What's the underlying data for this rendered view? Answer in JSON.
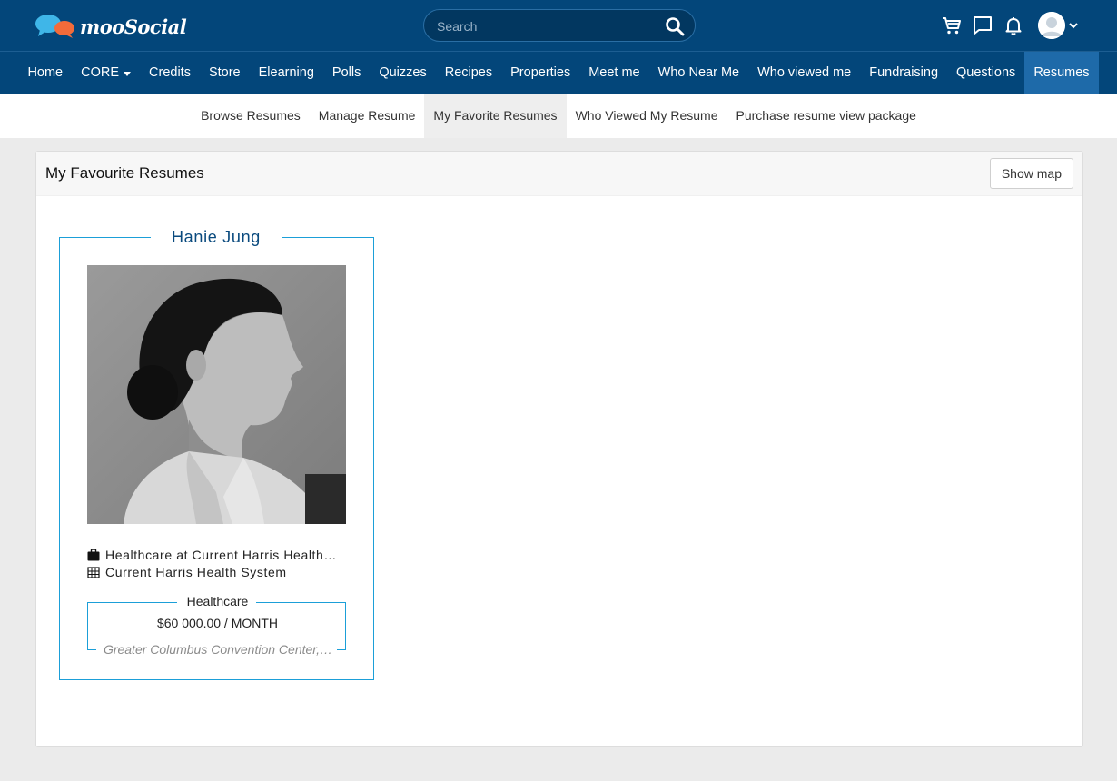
{
  "header": {
    "brand": "mooSocial",
    "search_placeholder": "Search"
  },
  "main_nav": [
    {
      "label": "Home"
    },
    {
      "label": "CORE"
    },
    {
      "label": "Credits"
    },
    {
      "label": "Store"
    },
    {
      "label": "Elearning"
    },
    {
      "label": "Polls"
    },
    {
      "label": "Quizzes"
    },
    {
      "label": "Recipes"
    },
    {
      "label": "Properties"
    },
    {
      "label": "Meet me"
    },
    {
      "label": "Who Near Me"
    },
    {
      "label": "Who viewed me"
    },
    {
      "label": "Fundraising"
    },
    {
      "label": "Questions"
    },
    {
      "label": "Resumes"
    }
  ],
  "sub_nav": [
    {
      "label": "Browse Resumes"
    },
    {
      "label": "Manage Resume"
    },
    {
      "label": "My Favorite Resumes"
    },
    {
      "label": "Who Viewed My Resume"
    },
    {
      "label": "Purchase resume view package"
    }
  ],
  "panel": {
    "title": "My Favourite Resumes",
    "show_map_label": "Show map"
  },
  "resume": {
    "name": "Hanie Jung",
    "job": "Healthcare at Current Harris Health…",
    "company": "Current Harris Health System",
    "category": "Healthcare",
    "salary": "$60 000.00 / MONTH",
    "location": "Greater Columbus Convention Center,…"
  },
  "colors": {
    "header_bg": "#03467a",
    "active_nav": "#1e6aa9",
    "card_border": "#1b9fd8",
    "name_color": "#0a4a7e"
  }
}
